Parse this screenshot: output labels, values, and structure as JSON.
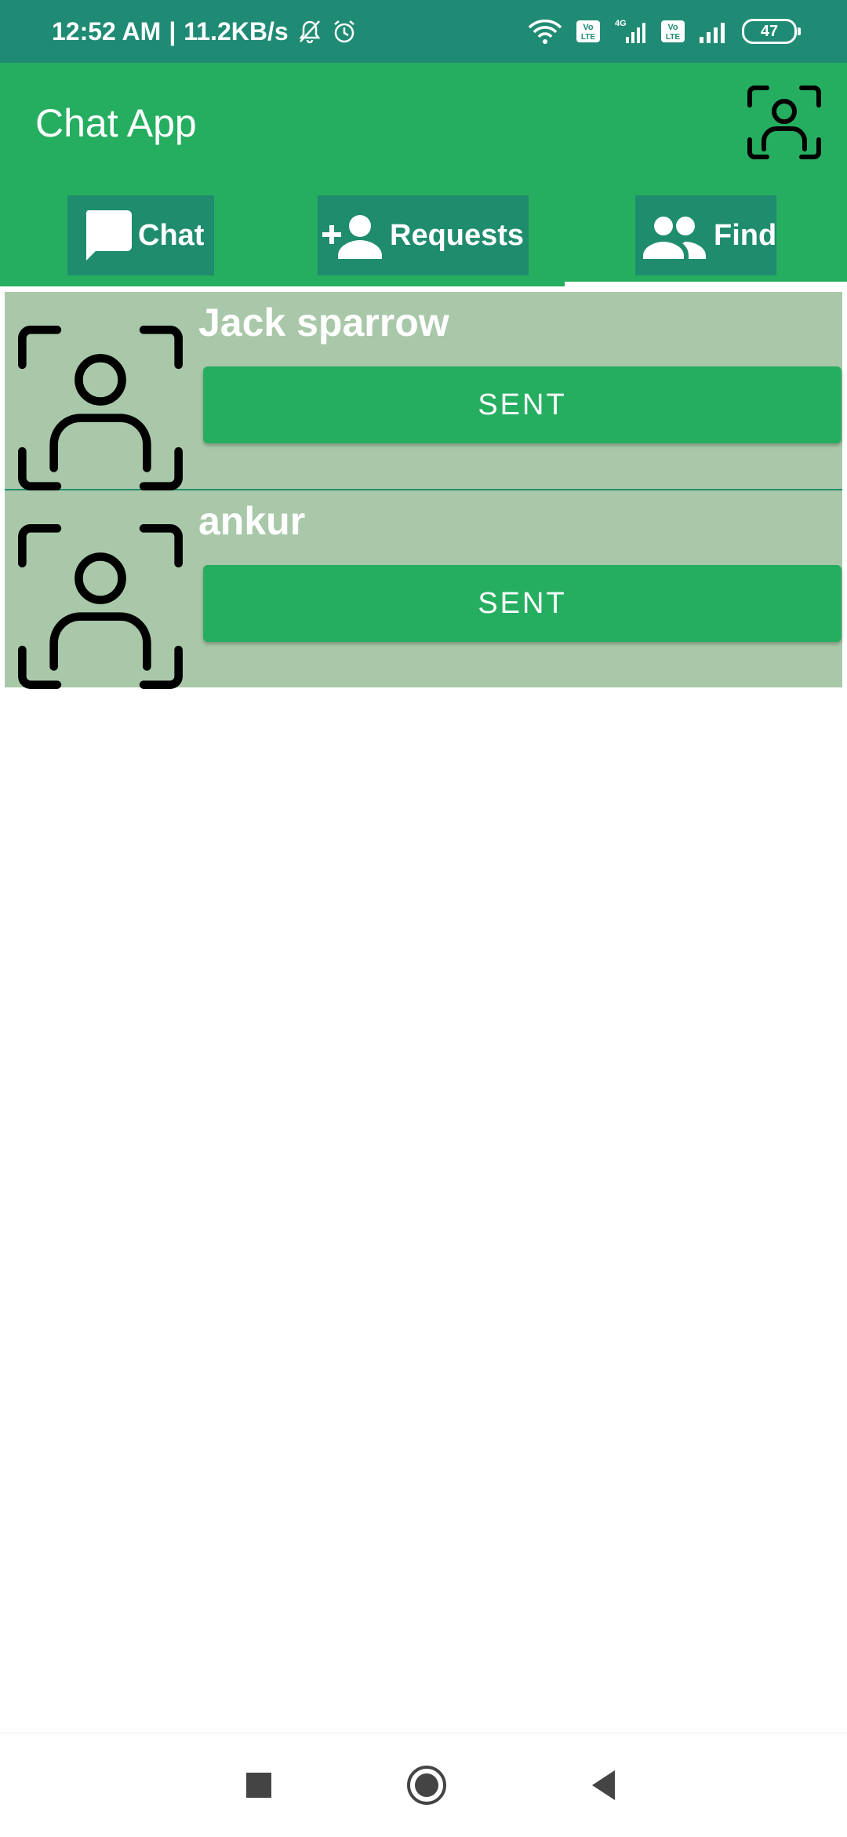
{
  "status_bar": {
    "time": "12:52 AM",
    "separator": "|",
    "speed": "11.2KB/s",
    "battery": "47",
    "icons": [
      "mute-bell-icon",
      "alarm-icon",
      "wifi-icon",
      "volte-icon",
      "4g-signal-icon",
      "volte-icon",
      "signal-icon",
      "battery-icon"
    ]
  },
  "app_bar": {
    "title": "Chat App",
    "action_icon": "face-scan-icon"
  },
  "tabs": [
    {
      "label": "Chat",
      "icon": "chat-bubble-icon"
    },
    {
      "label": "Requests",
      "icon": "add-person-icon"
    },
    {
      "label": "Find",
      "icon": "people-icon"
    }
  ],
  "selected_tab": "Find",
  "users": [
    {
      "name": "Jack sparrow",
      "button": "SENT",
      "avatar_icon": "face-scan-icon"
    },
    {
      "name": "ankur",
      "button": "SENT",
      "avatar_icon": "face-scan-icon"
    }
  ],
  "nav_bar": {
    "icons": [
      "recents-icon",
      "home-icon",
      "back-icon"
    ]
  },
  "colors": {
    "status_bar": "#208b74",
    "primary": "#26ae60",
    "tab_bg": "#1f8c6e",
    "row_bg": "#a9c8a9",
    "text_on_primary": "#ffffff"
  }
}
